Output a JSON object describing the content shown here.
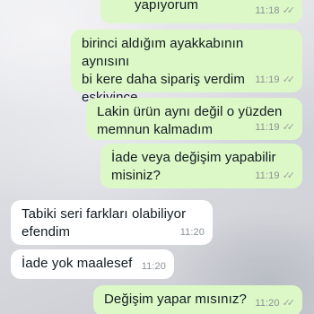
{
  "messages": [
    {
      "direction": "out",
      "text": "yapıyorum",
      "time": "11:18",
      "status": "read-ticks"
    },
    {
      "direction": "out",
      "text": "birinci aldığım ayakkabının aynısını\nbi kere daha sipariş verdim\neskiyince",
      "time": "11:19",
      "status": "read-ticks"
    },
    {
      "direction": "out",
      "text": "Lakin ürün aynı değil o yüzden\nmemnun kalmadım",
      "time": "11:19",
      "status": "read-ticks"
    },
    {
      "direction": "out",
      "text": "İade veya değişim yapabilir\nmisiniz?",
      "time": "11:19",
      "status": "read-ticks"
    },
    {
      "direction": "in",
      "text": "Tabiki seri farkları olabiliyor\nefendim",
      "time": "11:20"
    },
    {
      "direction": "in",
      "text": "İade yok maalesef",
      "time": "11:20"
    },
    {
      "direction": "out",
      "text": "Değişim yapar mısınız?",
      "time": "11:20",
      "status": "read-ticks"
    }
  ],
  "colors": {
    "outgoing_bubble": "#dcf8c6",
    "incoming_bubble": "#ffffff",
    "timestamp": "#8a9197"
  }
}
